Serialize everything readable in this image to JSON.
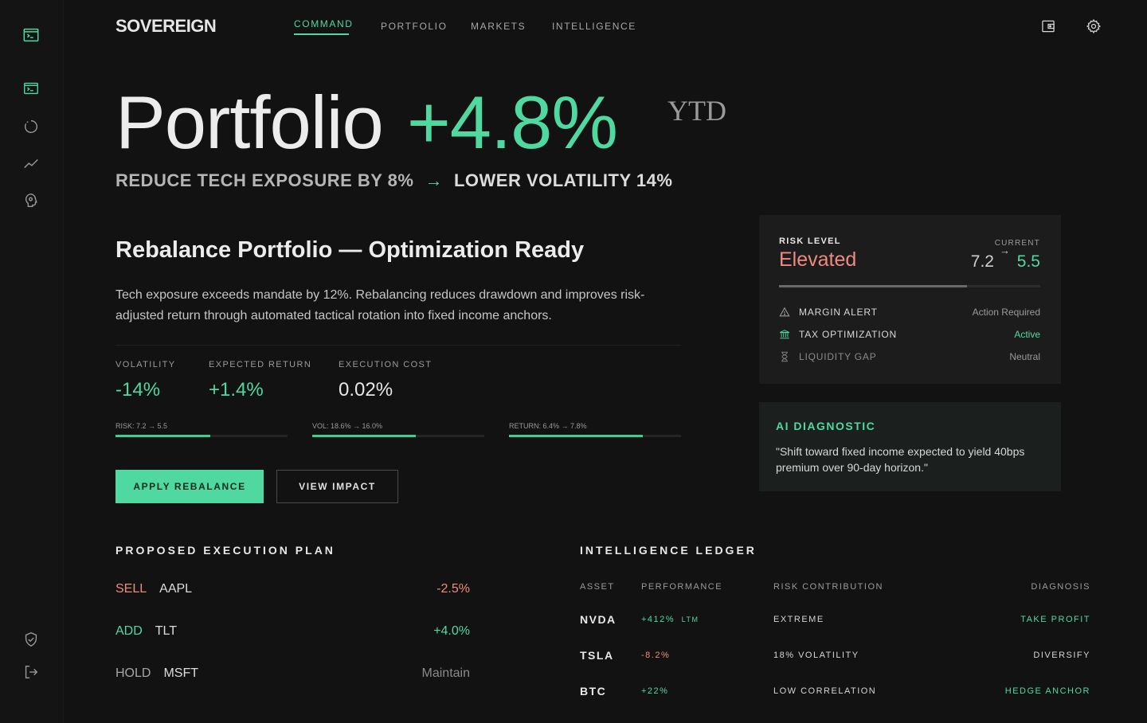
{
  "brand": "SOVEREIGN",
  "nav": [
    "COMMAND",
    "PORTFOLIO",
    "MARKETS",
    "INTELLIGENCE"
  ],
  "hero": {
    "word": "Portfolio",
    "change": "+4.8%",
    "period": "YTD",
    "action": "REDUCE TECH EXPOSURE BY 8%",
    "arrow": "→",
    "result": "LOWER VOLATILITY 14%"
  },
  "rebalance": {
    "title": "Rebalance Portfolio — Optimization Ready",
    "description": "Tech exposure exceeds mandate by 12%. Rebalancing reduces drawdown and improves risk-adjusted return through automated tactical rotation into fixed income anchors.",
    "metrics": [
      {
        "label": "VOLATILITY",
        "value": "-14%"
      },
      {
        "label": "EXPECTED RETURN",
        "value": "+1.4%"
      },
      {
        "label": "EXECUTION COST",
        "value": "0.02%"
      }
    ],
    "bars": [
      {
        "label": "RISK: 7.2 → 5.5",
        "fill": 0.55
      },
      {
        "label": "VOL: 18.6% → 16.0%",
        "fill": 0.6
      },
      {
        "label": "RETURN: 6.4% → 7.8%",
        "fill": 0.78
      }
    ],
    "apply_label": "APPLY REBALANCE",
    "impact_label": "VIEW IMPACT"
  },
  "plan": {
    "title": "PROPOSED EXECUTION PLAN",
    "rows": [
      {
        "action": "SELL",
        "ticker": "AAPL",
        "value": "-2.5%"
      },
      {
        "action": "ADD",
        "ticker": "TLT",
        "value": "+4.0%"
      },
      {
        "action": "HOLD",
        "ticker": "MSFT",
        "value": "Maintain"
      }
    ]
  },
  "ledger": {
    "title": "INTELLIGENCE LEDGER",
    "headers": [
      "ASSET",
      "PERFORMANCE",
      "RISK CONTRIBUTION",
      "DIAGNOSIS"
    ],
    "rows": [
      {
        "asset": "NVDA",
        "perf": "+412%",
        "perf_note": "LTM",
        "risk": "EXTREME",
        "diagnosis": "TAKE PROFIT"
      },
      {
        "asset": "TSLA",
        "perf": "-8.2%",
        "perf_note": "",
        "risk": "18% VOLATILITY",
        "diagnosis": "DIVERSIFY"
      },
      {
        "asset": "BTC",
        "perf": "+22%",
        "perf_note": "",
        "risk": "LOW CORRELATION",
        "diagnosis": "HEDGE ANCHOR"
      }
    ]
  },
  "risk": {
    "label": "RISK LEVEL",
    "level": "Elevated",
    "current_label": "CURRENT",
    "from": "7.2",
    "arrow": "→",
    "to": "5.5",
    "level_fill": 0.72,
    "rows": [
      {
        "name": "MARGIN ALERT",
        "status": "Action Required",
        "icon": "warning-icon"
      },
      {
        "name": "TAX OPTIMIZATION",
        "status": "Active",
        "icon": "bank-icon"
      },
      {
        "name": "LIQUIDITY GAP",
        "status": "Neutral",
        "icon": "hourglass-icon"
      }
    ]
  },
  "ai": {
    "title": "AI DIAGNOSTIC",
    "text": "\"Shift toward fixed income expected to yield 40bps premium over 90-day horizon.\""
  },
  "colors": {
    "accent": "#4fd9a0",
    "negative": "#ef8b7e",
    "background": "#121212"
  },
  "icons": {
    "rail": [
      "terminal-icon",
      "terminal-icon",
      "circle-icon",
      "trend-icon",
      "brain-icon",
      "shield-check-icon",
      "logout-icon"
    ],
    "top": [
      "wallet-icon",
      "gear-icon"
    ]
  }
}
